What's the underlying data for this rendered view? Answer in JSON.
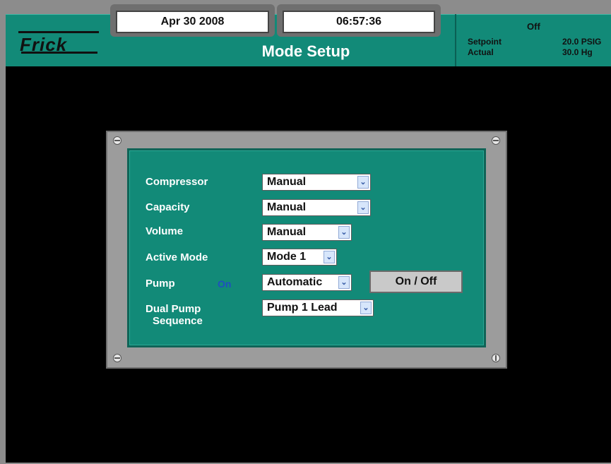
{
  "header": {
    "date": "Apr 30 2008",
    "time": "06:57:36",
    "logo_text": "Frick",
    "title": "Mode Setup",
    "status": "Off",
    "setpoint_label": "Setpoint",
    "setpoint_value": "20.0 PSIG",
    "actual_label": "Actual",
    "actual_value": "30.0 Hg"
  },
  "form": {
    "compressor": {
      "label": "Compressor",
      "value": "Manual"
    },
    "capacity": {
      "label": "Capacity",
      "value": "Manual"
    },
    "volume": {
      "label": "Volume",
      "value": "Manual"
    },
    "active_mode": {
      "label": "Active Mode",
      "value": "Mode 1"
    },
    "pump": {
      "label": "Pump",
      "state": "On",
      "value": "Automatic",
      "button_label": "On / Off"
    },
    "dual_pump": {
      "label_line1": "Dual Pump",
      "label_line2": "Sequence",
      "value": "Pump 1 Lead"
    }
  },
  "colors": {
    "panel_teal": "#128a78",
    "frame_gray": "#8c8c8c",
    "screen_black": "#000000",
    "pump_state_blue": "#1f4fbf"
  },
  "icons": {
    "dropdown": "chevron-down-icon",
    "screw": "screw-icon"
  }
}
